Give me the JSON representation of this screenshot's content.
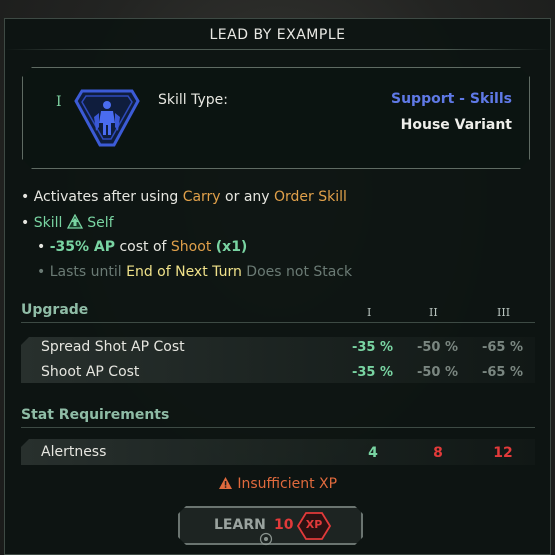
{
  "title": "LEAD BY EXAMPLE",
  "skill": {
    "rank": "I",
    "type_label": "Skill Type:",
    "type_value": "Support - Skills",
    "variant": "House Variant",
    "emblem_icon": "soldier-emblem-icon"
  },
  "description": {
    "line1": {
      "bullet": "•",
      "prefix": "Activates after using",
      "carry": "Carry",
      "mid": "or any",
      "order": "Order Skill"
    },
    "line2": {
      "bullet": "•",
      "skill": "Skill",
      "self": "Self",
      "icon": "up-arrow-icon"
    },
    "line3": {
      "bullet": "•",
      "amount": "-35% AP",
      "mid": "cost of",
      "shoot": "Shoot",
      "mult": "(x1)"
    },
    "line4": {
      "bullet": "•",
      "prefix": "Lasts until",
      "until": "End of Next Turn",
      "suffix": "Does not Stack"
    }
  },
  "upgrade": {
    "header": "Upgrade",
    "columns": [
      "I",
      "II",
      "III"
    ],
    "rows": [
      {
        "label": "Spread Shot AP Cost",
        "values": [
          "-35 %",
          "-50 %",
          "-65 %"
        ]
      },
      {
        "label": "Shoot AP Cost",
        "values": [
          "-35 %",
          "-50 %",
          "-65 %"
        ]
      }
    ]
  },
  "requirements": {
    "header": "Stat Requirements",
    "rows": [
      {
        "label": "Alertness",
        "values": [
          "4",
          "8",
          "12"
        ]
      }
    ]
  },
  "warning": {
    "icon": "warning-icon",
    "text": "Insufficient XP"
  },
  "learn": {
    "label": "LEARN",
    "cost": "10",
    "badge": "XP"
  },
  "colors": {
    "support": "#5f79e6",
    "positive": "#79d4a2",
    "keyword": "#e0a04a",
    "unmet": "#e23a3a",
    "warning": "#e06a3d"
  }
}
